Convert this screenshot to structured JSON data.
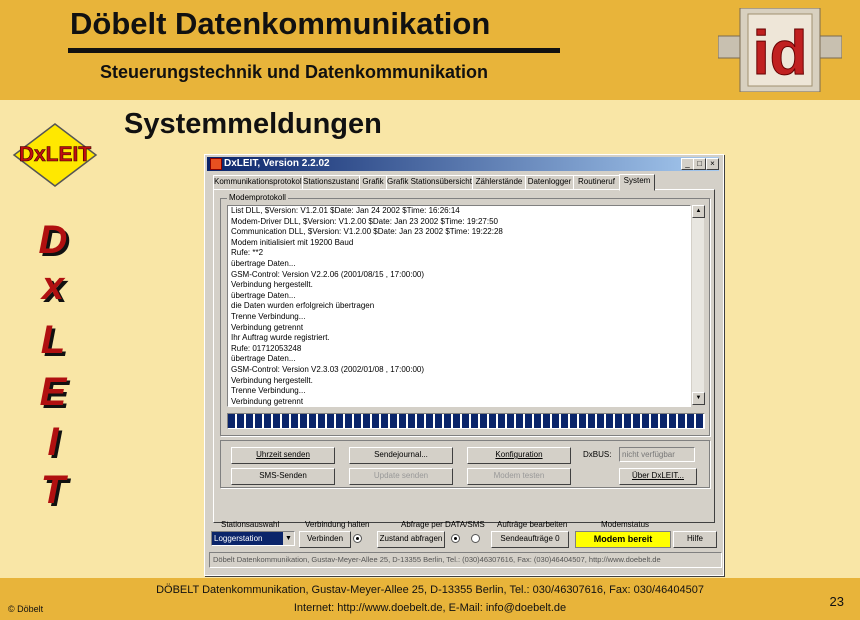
{
  "slide": {
    "title": "Döbelt Datenkommunikation",
    "subtitle": "Steuerungstechnik und Datenkommunikation",
    "heading": "Systemmeldungen",
    "id_logo_text": "id",
    "dx_logo_text": "DxLEIT",
    "vertical_letters": [
      "D",
      "x",
      "L",
      "E",
      "I",
      "T"
    ],
    "footer_line1": "DÖBELT Datenkommunikation, Gustav-Meyer-Allee 25, D-13355 Berlin, Tel.: 030/46307616, Fax: 030/46404507",
    "footer_line2": "Internet: http://www.doebelt.de, E-Mail: info@doebelt.de",
    "copyright": "© Döbelt",
    "page_number": "23"
  },
  "window": {
    "title": "DxLEIT, Version 2.2.02",
    "buttons": [
      "_",
      "□",
      "×"
    ],
    "tabs": [
      "Kommunikationsprotokoll",
      "Stationszustand",
      "Grafik",
      "Grafik Stationsübersicht",
      "Zählerstände",
      "Datenlogger",
      "Routineruf",
      "System"
    ],
    "active_tab": "System",
    "log_group_label": "Modemprotokoll",
    "log_lines": [
      "List DLL, $Version: V1.2.01 $Date: Jan 24 2002 $Time: 16:26:14",
      "Modem-Driver DLL, $Version: V1.2.00 $Date: Jan 23 2002 $Time: 19:27:50",
      "Communication DLL, $Version: V1.2.00 $Date: Jan 23 2002 $Time: 19:22:28",
      "Modem initialisiert mit 19200 Baud",
      "Rufe: **2",
      "übertrage Daten...",
      "GSM-Control: Version V2.2.06  (2001/08/15 , 17:00:00)",
      "Verbindung hergestellt.",
      "übertrage Daten...",
      "die Daten wurden erfolgreich übertragen",
      "Trenne Verbindung...",
      "Verbindung getrennt",
      "Ihr Auftrag wurde registriert.",
      "Rufe: 01712053248",
      "übertrage Daten...",
      "GSM-Control: Version V2.3.03  (2002/01/08 , 17:00:00)",
      "Verbindung hergestellt.",
      "Trenne Verbindung...",
      "Verbindung getrennt"
    ],
    "progress_fraction": 1.0,
    "buttons_row1": {
      "uhrzeit": "Uhrzeit senden",
      "sendejournal": "Sendejournal...",
      "konfiguration": "Konfiguration"
    },
    "buttons_row2": {
      "sms": "SMS-Senden",
      "update": "Update senden",
      "modem_testen": "Modem testen",
      "ueber": "Über DxLEIT..."
    },
    "dxbus_label": "DxBUS:",
    "dxbus_value": "nicht verfügbar",
    "bottom": {
      "stationsauswahl_label": "Stationsauswahl",
      "station_selected": "Loggerstation",
      "verbindung_label": "Verbindung  halten",
      "verbinden_button": "Verbinden",
      "abfrage_label": "Abfrage per   DATA/SMS",
      "zustand_button": "Zustand abfragen",
      "auftraege_label": "Aufträge bearbeiten",
      "sendeauftraege_button": "Sendeaufträge 0",
      "modemstatus_label": "Modemstatus",
      "modem_status": "Modem bereit",
      "hilfe_button": "Hilfe"
    },
    "statusbar": "Döbelt Datenkommunikation, Gustav-Meyer-Allee 25, D-13355 Berlin, Tel.: (030)46307616, Fax: (030)46404507, http://www.doebelt.de"
  },
  "colors": {
    "header_bg": "#e8b43a",
    "slide_bg": "#f9e6a6",
    "title_bar": "#0a246a",
    "modem_status_bg": "#ffff00",
    "letter_red": "#b01010"
  }
}
